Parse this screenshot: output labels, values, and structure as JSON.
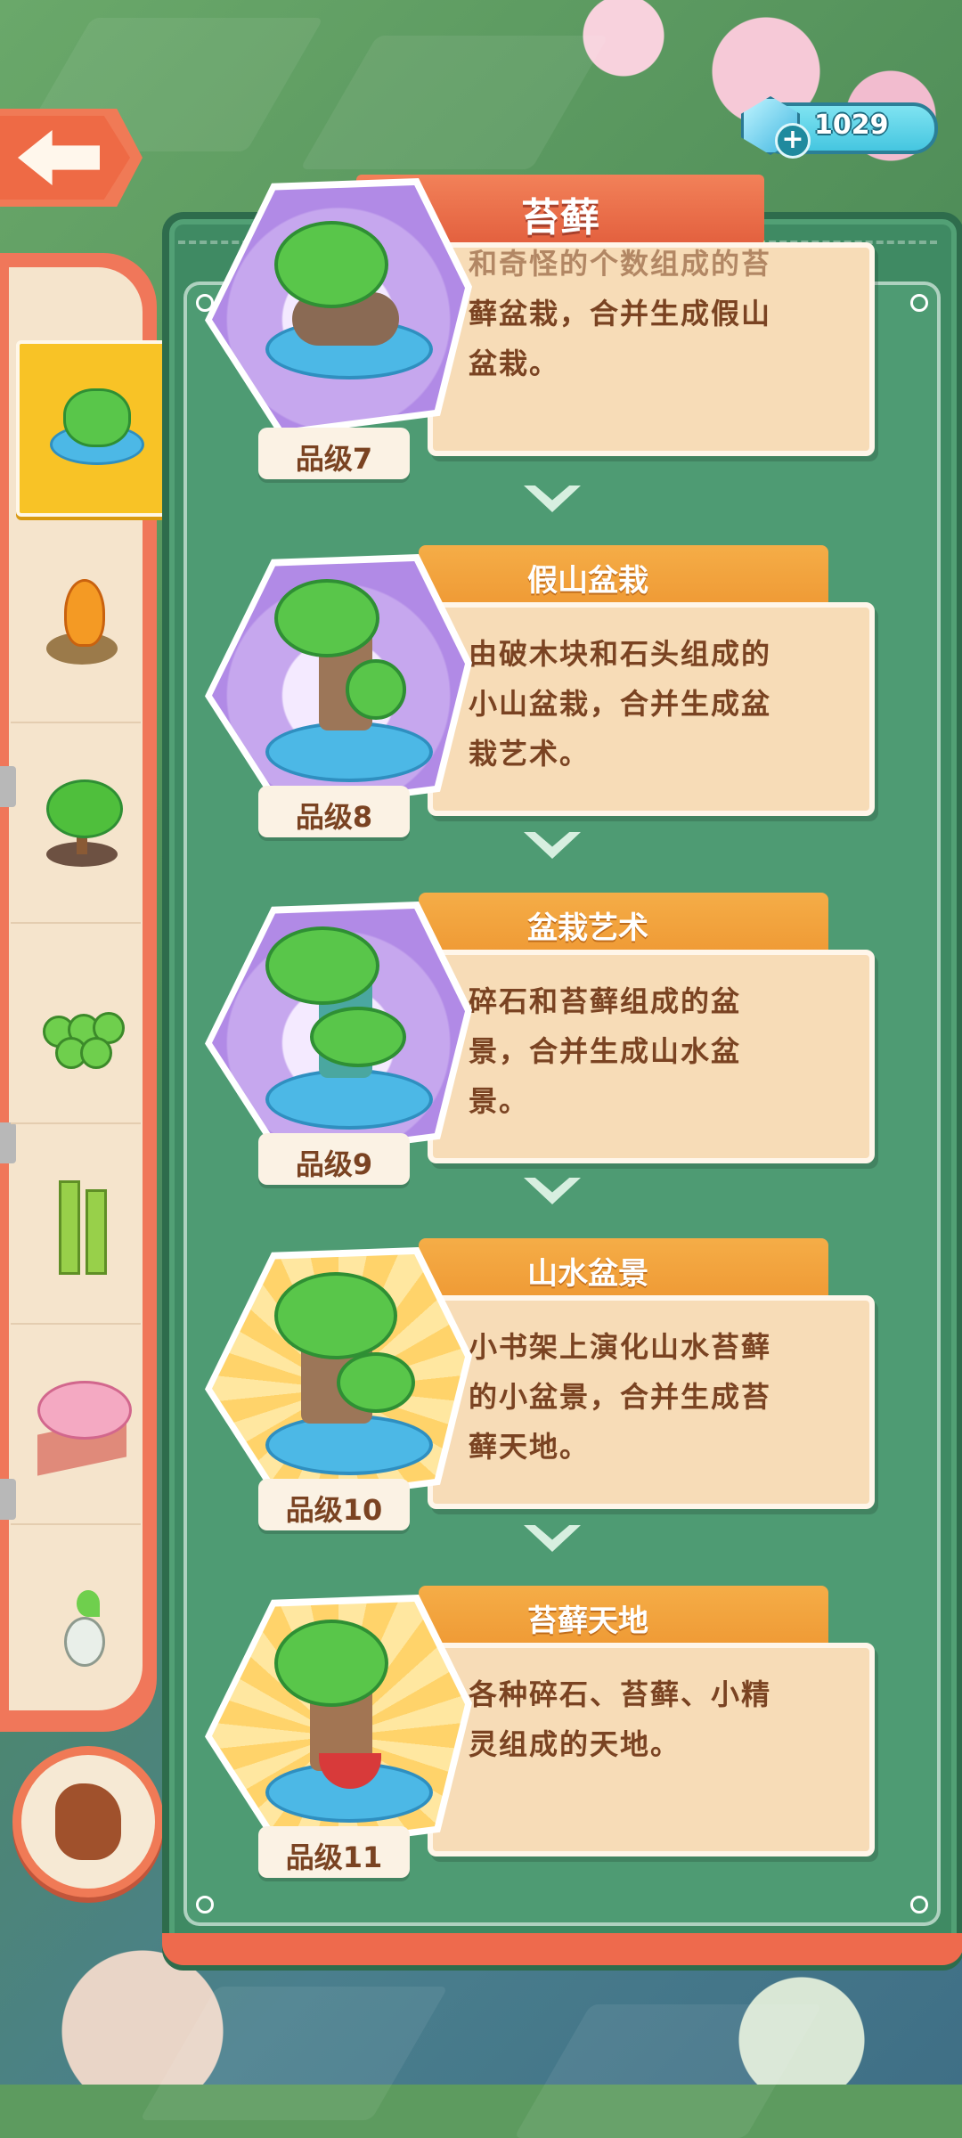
{
  "top_bar": {
    "gems": "1029",
    "gem_icon": "diamond-icon",
    "plus_icon": "plus-icon"
  },
  "panel": {
    "title": "苔藓"
  },
  "sidebar": {
    "items": [
      {
        "icon": "moss-bonsai-icon",
        "active": true
      },
      {
        "icon": "carrot-mound-icon",
        "active": false
      },
      {
        "icon": "small-tree-icon",
        "active": false
      },
      {
        "icon": "grapes-icon",
        "active": false
      },
      {
        "icon": "bamboo-icon",
        "active": false
      },
      {
        "icon": "cherry-blossom-garden-icon",
        "active": false
      },
      {
        "icon": "radish-seed-icon",
        "active": false
      }
    ],
    "hand_button_icon": "pointing-hand-icon"
  },
  "cards": [
    {
      "name": "",
      "desc": "…蘚盆栽，合并生成假山盆栽。",
      "desc_lines": [
        "和奇怪的个数组成的苔",
        "藓盆栽，合并生成假山",
        "盆栽。"
      ],
      "grade": "品级7",
      "bg": "purple"
    },
    {
      "name": "假山盆栽",
      "desc_lines": [
        "由破木块和石头组成的",
        "小山盆栽，合并生成盆",
        "栽艺术。"
      ],
      "grade": "品级8",
      "bg": "purple"
    },
    {
      "name": "盆栽艺术",
      "desc_lines": [
        "碎石和苔藓组成的盆",
        "景，合并生成山水盆",
        "景。"
      ],
      "grade": "品级9",
      "bg": "purple"
    },
    {
      "name": "山水盆景",
      "desc_lines": [
        "小书架上演化山水苔藓",
        "的小盆景，合并生成苔",
        "藓天地。"
      ],
      "grade": "品级10",
      "bg": "gold"
    },
    {
      "name": "苔藓天地",
      "desc_lines": [
        "各种碎石、苔藓、小精",
        "灵组成的天地。"
      ],
      "grade": "品级11",
      "bg": "gold"
    }
  ]
}
